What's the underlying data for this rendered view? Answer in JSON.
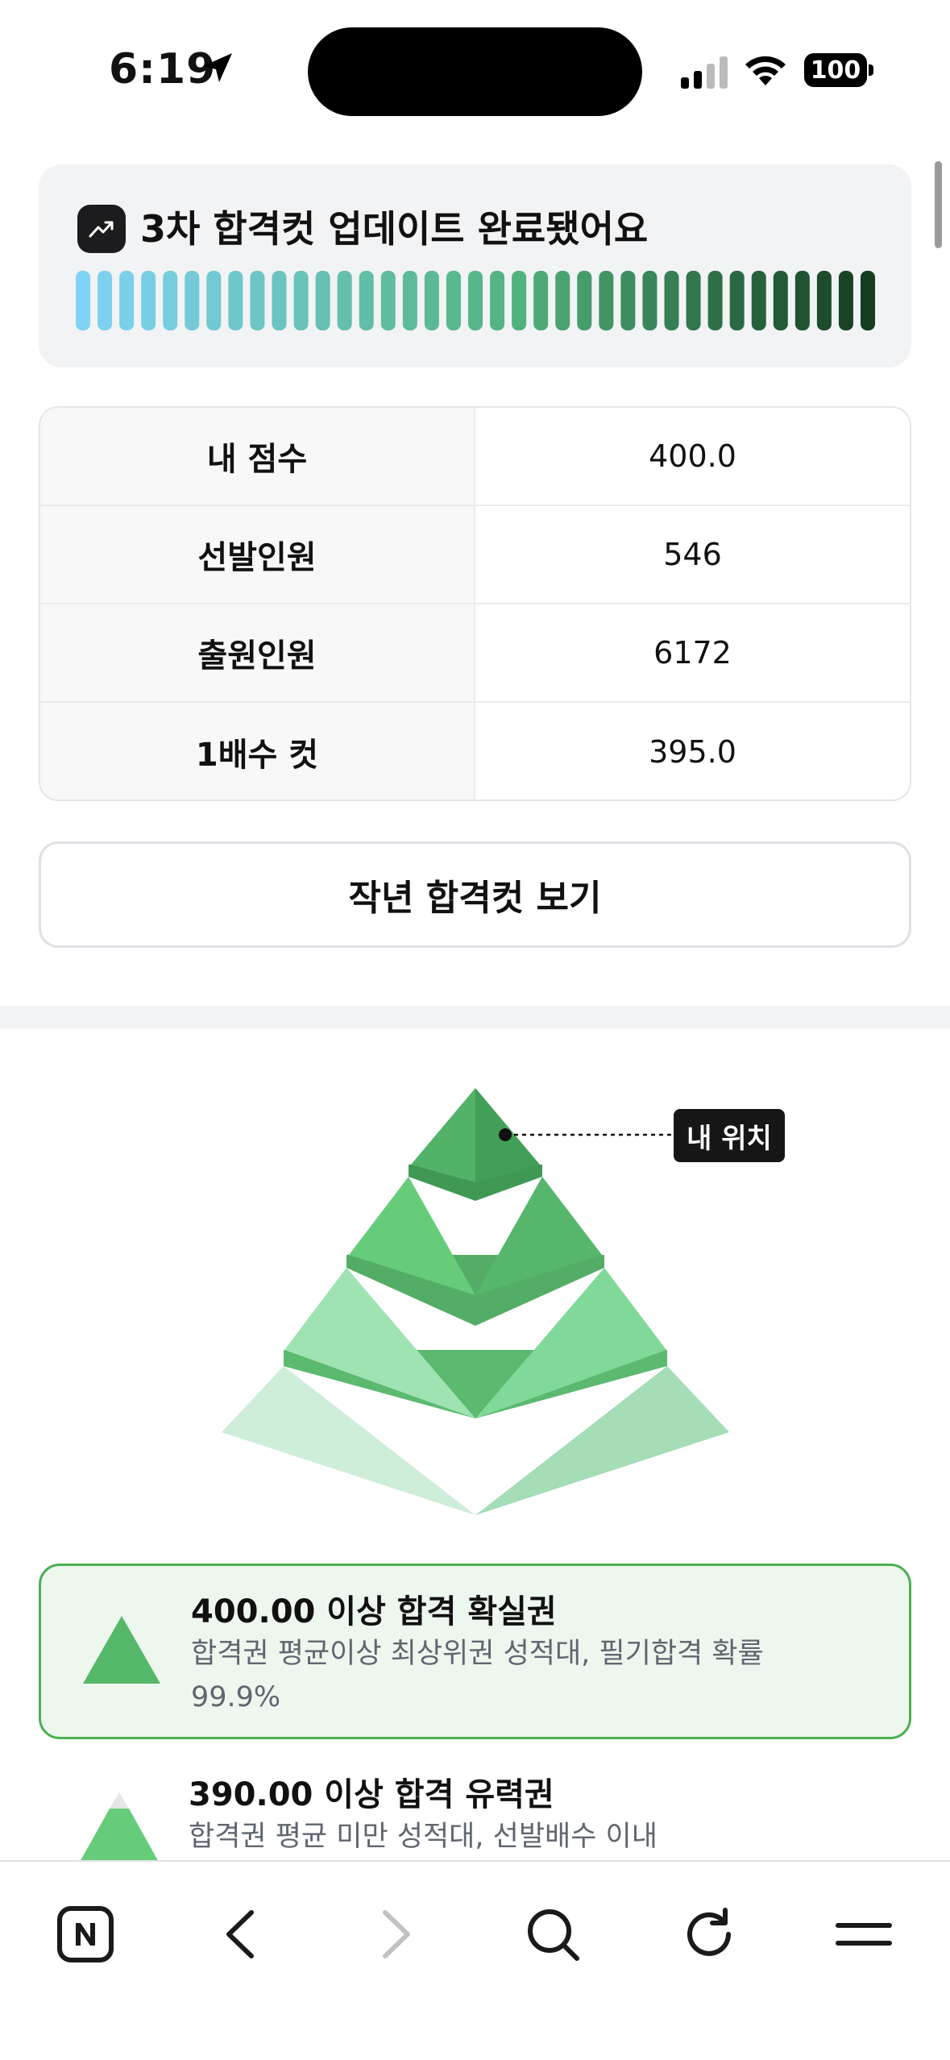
{
  "status_bar": {
    "time": "6:19",
    "battery": "100"
  },
  "update_card": {
    "title": "3차 합격컷 업데이트 완료됐어요",
    "icon": "trend-up-icon",
    "progress": 1.0,
    "colors": {
      "start": "#7fd3f5",
      "mid": "#52b37e",
      "end": "#143d1f"
    }
  },
  "info_table": {
    "rows": [
      {
        "label": "내 점수",
        "value": "400.0"
      },
      {
        "label": "선발인원",
        "value": "546"
      },
      {
        "label": "출원인원",
        "value": "6172"
      },
      {
        "label": "1배수 컷",
        "value": "395.0"
      }
    ]
  },
  "lastyear_button": {
    "label": "작년 합격컷 보기"
  },
  "pyramid": {
    "my_position_label": "내 위치",
    "my_tier_index": 0,
    "colors": [
      "#52b76a",
      "#64cc7a",
      "#8ddda0",
      "#bfe8cd"
    ]
  },
  "tiers": [
    {
      "title": "400.00 이상 합격 확실권",
      "description": "합격권 평균이상 최상위권 성적대, 필기합격 확률 99.9%",
      "highlighted": true,
      "color": "#55b86a"
    },
    {
      "title": "390.00 이상 합격 유력권",
      "description": "합격권 평균 미만 성적대, 선발배수 이내",
      "highlighted": false,
      "color": "#66cc7a"
    }
  ],
  "toolbar": {
    "items": [
      "naver-home-icon",
      "back-icon",
      "forward-icon",
      "search-icon",
      "reload-icon",
      "menu-icon"
    ]
  }
}
